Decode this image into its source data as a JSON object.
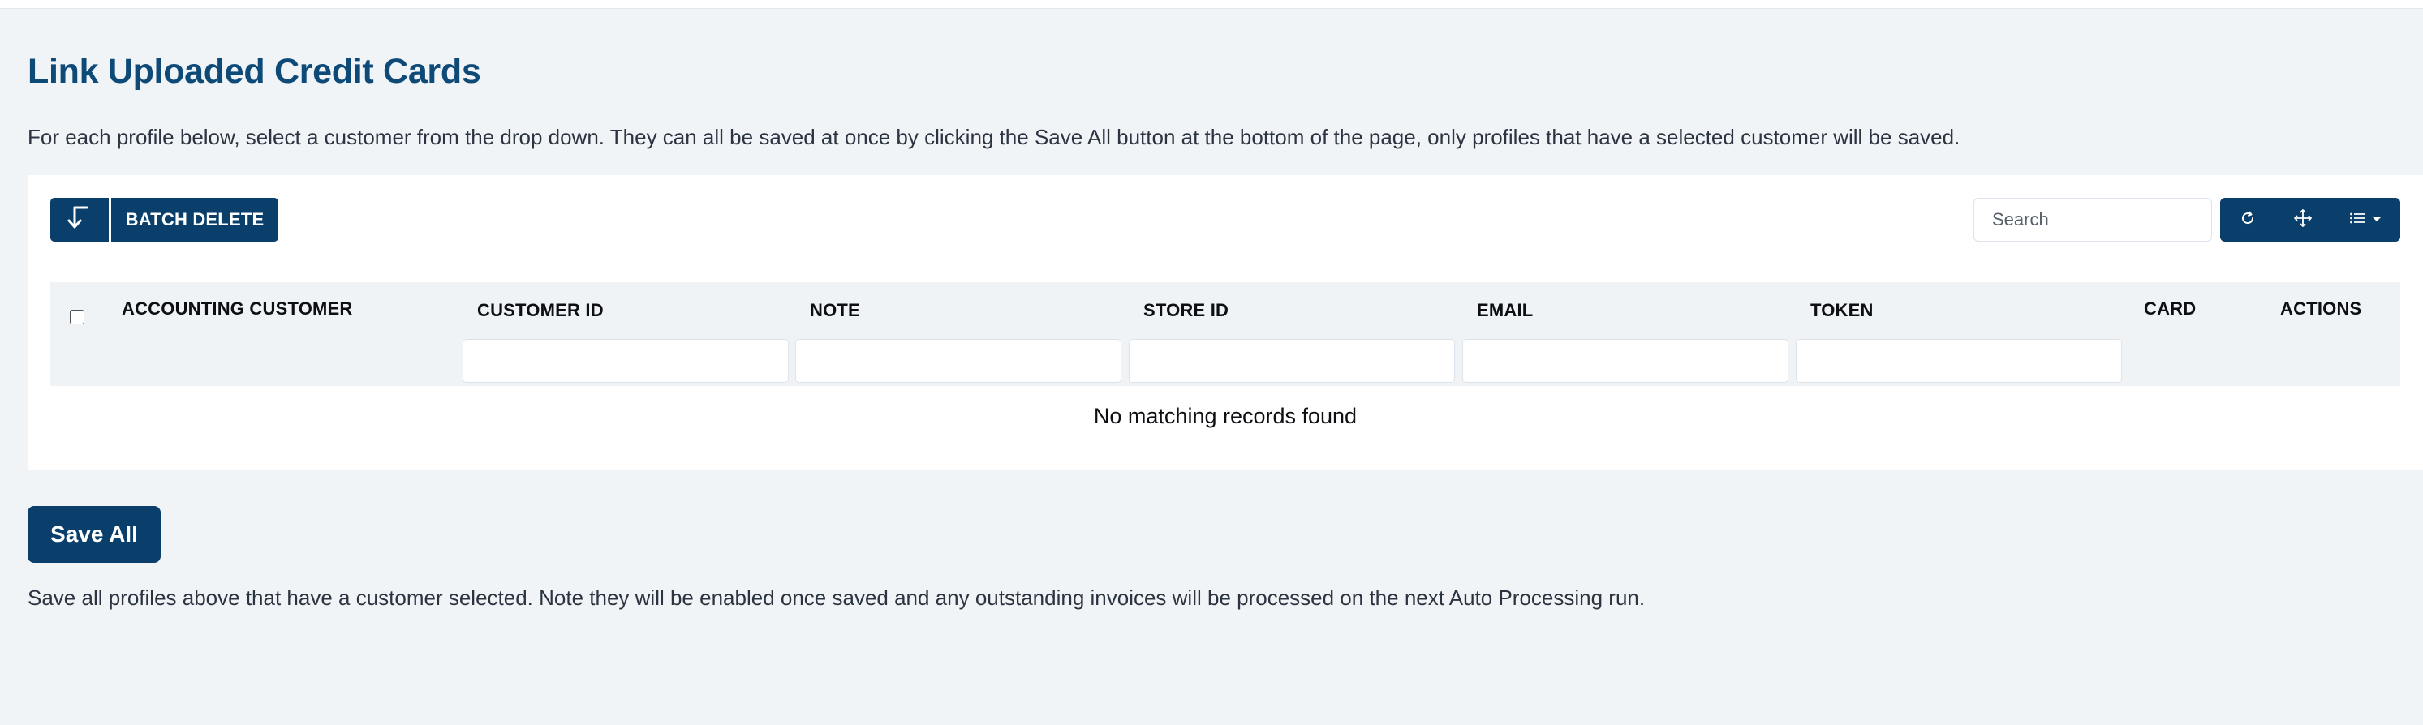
{
  "page": {
    "title": "Link Uploaded Credit Cards",
    "intro": "For each profile below, select a customer from the drop down. They can all be saved at once by clicking the Save All button at the bottom of the page, only profiles that have a selected customer will be saved."
  },
  "toolbar": {
    "export_icon": "arrow-down-icon",
    "batch_delete_label": "BATCH DELETE",
    "search_placeholder": "Search",
    "tools": [
      {
        "name": "refresh-icon"
      },
      {
        "name": "move-icon"
      },
      {
        "name": "columns-list-icon"
      }
    ]
  },
  "table": {
    "columns": [
      {
        "key": "accounting_customer",
        "label": "ACCOUNTING CUSTOMER",
        "filter": false
      },
      {
        "key": "customer_id",
        "label": "CUSTOMER ID",
        "filter": true
      },
      {
        "key": "note",
        "label": "NOTE",
        "filter": true
      },
      {
        "key": "store_id",
        "label": "STORE ID",
        "filter": true
      },
      {
        "key": "email",
        "label": "EMAIL",
        "filter": true
      },
      {
        "key": "token",
        "label": "TOKEN",
        "filter": true
      },
      {
        "key": "card",
        "label": "CARD",
        "filter": false
      },
      {
        "key": "actions",
        "label": "ACTIONS",
        "filter": false
      }
    ],
    "rows": [],
    "empty_message": "No matching records found"
  },
  "footer": {
    "save_all_label": "Save All",
    "note": "Save all profiles above that have a customer selected. Note they will be enabled once saved and any outstanding invoices will be processed on the next Auto Processing run."
  },
  "colors": {
    "primary": "#0a3f6b",
    "title": "#0e4a78",
    "background": "#f1f4f7",
    "header_row": "#eff3f6"
  }
}
